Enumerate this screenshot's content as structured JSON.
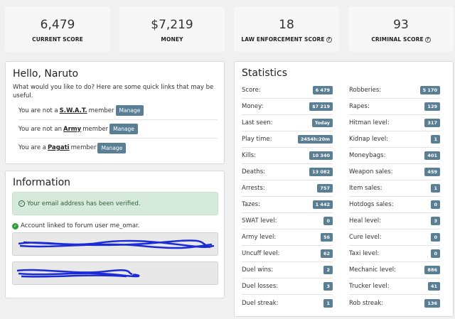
{
  "cards": [
    {
      "value": "6,479",
      "label": "CURRENT SCORE",
      "help": false
    },
    {
      "value": "$7,219",
      "label": "MONEY",
      "help": false
    },
    {
      "value": "18",
      "label": "LAW ENFORCEMENT SCORE",
      "help": true
    },
    {
      "value": "93",
      "label": "CRIMINAL SCORE",
      "help": true
    }
  ],
  "hello": {
    "title": "Hello, Naruto",
    "subtitle": "What would you like to do? Here are some quick links that may be useful.",
    "manage_label": "Manage",
    "rows": [
      {
        "prefix": "You are not a",
        "group": "S.W.A.T.",
        "suffix": "member"
      },
      {
        "prefix": "You are not an",
        "group": "Army",
        "suffix": "member"
      },
      {
        "prefix": "You are a",
        "group": "Pagati",
        "suffix": "member"
      }
    ]
  },
  "info": {
    "title": "Information",
    "alert": "Your email address has been verified.",
    "linked": "Account linked to forum user me_omar."
  },
  "stats": {
    "title": "Statistics",
    "left": [
      {
        "label": "Score:",
        "value": "6 479"
      },
      {
        "label": "Money:",
        "value": "$7 219"
      },
      {
        "label": "Last seen:",
        "value": "Today"
      },
      {
        "label": "Play time:",
        "value": "2454h:20m"
      },
      {
        "label": "Kills:",
        "value": "10 340"
      },
      {
        "label": "Deaths:",
        "value": "13 082"
      },
      {
        "label": "Arrests:",
        "value": "757"
      },
      {
        "label": "Tazes:",
        "value": "1 442"
      },
      {
        "label": "SWAT level:",
        "value": "0"
      },
      {
        "label": "Army level:",
        "value": "56"
      },
      {
        "label": "Uncuff level:",
        "value": "62"
      },
      {
        "label": "Duel wins:",
        "value": "2"
      },
      {
        "label": "Duel losses:",
        "value": "3"
      },
      {
        "label": "Duel streak:",
        "value": "1"
      }
    ],
    "right": [
      {
        "label": "Robberies:",
        "value": "5 170"
      },
      {
        "label": "Rapes:",
        "value": "129"
      },
      {
        "label": "Hitman level:",
        "value": "317"
      },
      {
        "label": "Kidnap level:",
        "value": "1"
      },
      {
        "label": "Moneybags:",
        "value": "401"
      },
      {
        "label": "Weapon sales:",
        "value": "459"
      },
      {
        "label": "Item sales:",
        "value": "1"
      },
      {
        "label": "Hotdogs sales:",
        "value": "0"
      },
      {
        "label": "Heal level:",
        "value": "3"
      },
      {
        "label": "Cure level:",
        "value": "0"
      },
      {
        "label": "Taxi level:",
        "value": "0"
      },
      {
        "label": "Mechanic level:",
        "value": "886"
      },
      {
        "label": "Trucker level:",
        "value": "41"
      },
      {
        "label": "Rob streak:",
        "value": "136"
      }
    ]
  },
  "colors": {
    "badge": "#5a7f94",
    "alert_bg": "#d5eadb",
    "check": "#2e9e3b",
    "scribble": "#1b2bd6"
  }
}
